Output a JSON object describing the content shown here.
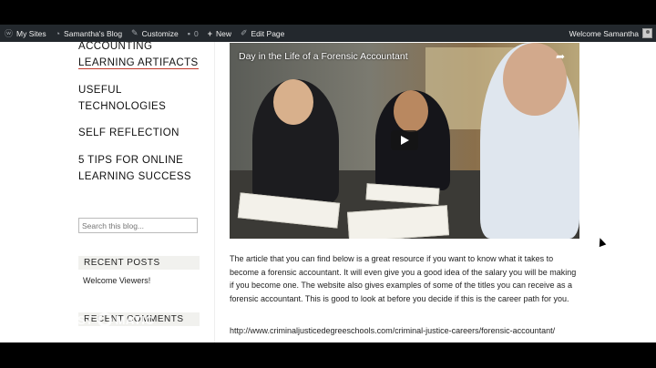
{
  "adminbar": {
    "my_sites": "My Sites",
    "blog_name": "Samantha's Blog",
    "customize": "Customize",
    "comments_count": "0",
    "new": "New",
    "edit_page": "Edit Page",
    "welcome": "Welcome Samantha"
  },
  "sidebar": {
    "nav": [
      {
        "label": "ACCOUNTING"
      },
      {
        "label": "LEARNING ARTIFACTS"
      },
      {
        "label": "USEFUL"
      },
      {
        "label": "TECHNOLOGIES"
      },
      {
        "label": "SELF REFLECTION"
      },
      {
        "label": "5 TIPS FOR ONLINE"
      },
      {
        "label": "LEARNING SUCCESS"
      }
    ],
    "search_placeholder": "Search this blog...",
    "recent_posts_title": "RECENT POSTS",
    "recent_posts": [
      "Welcome Viewers!"
    ],
    "recent_comments_title": "RECENT COMMENTS"
  },
  "video": {
    "title": "Day in the Life of a Forensic Accountant"
  },
  "article": {
    "body": "The article that you can find below is a great resource if you want to know what it takes to become a forensic accountant. It will even give you a good idea of the salary you will be making if you become one. The website also gives examples of some of the titles you can receive as a forensic accountant. This is good to look at before you decide if this is the career path for you.",
    "link": "http://www.criminaljusticedegreeschools.com/criminal-justice-careers/forensic-accountant/"
  },
  "watermark": {
    "line1": "RECORDED WITH",
    "line2a": "SCREENCAST",
    "line2b": "MATIC"
  }
}
